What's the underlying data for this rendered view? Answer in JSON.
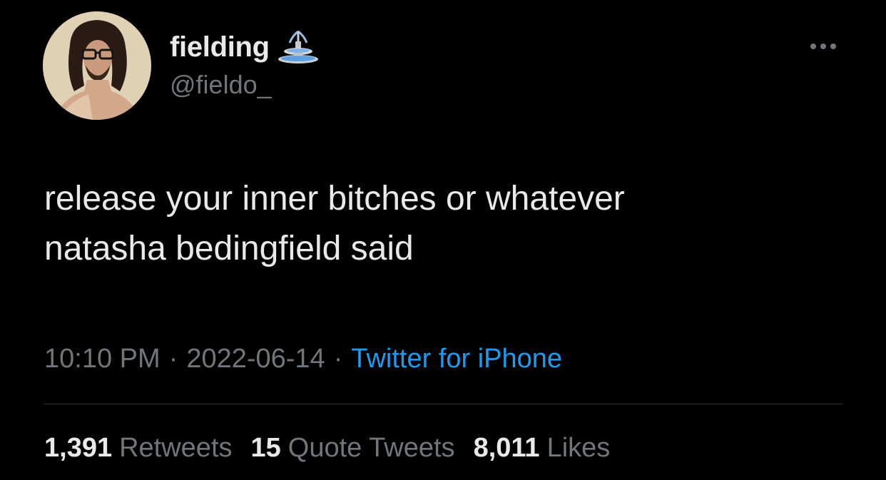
{
  "author": {
    "display_name": "fielding",
    "handle": "@fieldo_",
    "badge_icon": "fountain-icon",
    "avatar_icon": "avatar-photo"
  },
  "tweet": {
    "text": "release your inner bitches or whatever\nnatasha bedingfield said"
  },
  "meta": {
    "time": "10:10 PM",
    "separator": "·",
    "date": "2022-06-14",
    "source": "Twitter for iPhone"
  },
  "stats": {
    "retweets": {
      "count": "1,391",
      "label": "Retweets"
    },
    "quotes": {
      "count": "15",
      "label": "Quote Tweets"
    },
    "likes": {
      "count": "8,011",
      "label": "Likes"
    }
  },
  "colors": {
    "background": "#000000",
    "text_primary": "#e7e9ea",
    "text_secondary": "#71767b",
    "link": "#1d9bf0",
    "divider": "#2f3336"
  },
  "icons": {
    "more": "more-horizontal-icon"
  }
}
